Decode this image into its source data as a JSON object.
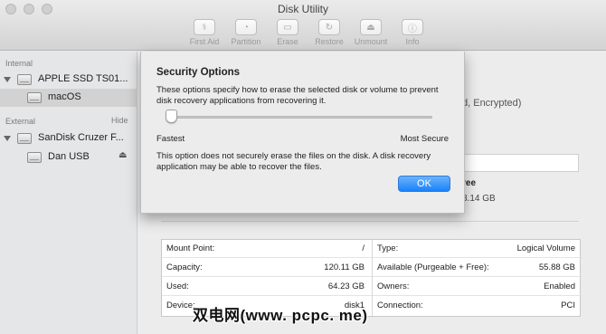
{
  "window": {
    "title": "Disk Utility"
  },
  "toolbar": {
    "buttons": [
      {
        "label": "First Aid",
        "icon": "stethoscope-icon",
        "glyph": "⚕"
      },
      {
        "label": "Partition",
        "icon": "pie-chart-icon",
        "glyph": "◔"
      },
      {
        "label": "Erase",
        "icon": "eraser-icon",
        "glyph": "▭"
      },
      {
        "label": "Restore",
        "icon": "restore-icon",
        "glyph": "↻"
      },
      {
        "label": "Unmount",
        "icon": "eject-icon",
        "glyph": "⏏"
      },
      {
        "label": "Info",
        "icon": "info-icon",
        "glyph": "ⓘ"
      }
    ]
  },
  "sidebar": {
    "internal_header": "Internal",
    "external_header": "External",
    "hide_label": "Hide",
    "items": [
      {
        "label": "APPLE SSD TS01...",
        "level": 0
      },
      {
        "label": "macOS",
        "level": 1
      },
      {
        "label": "SanDisk Cruzer F...",
        "level": 0
      },
      {
        "label": "Dan USB",
        "level": 1
      }
    ]
  },
  "main": {
    "volume_desc_partial": "d, Encrypted)",
    "free_label_partial": "ree",
    "free_value_partial": "8.14 GB",
    "info_left": [
      {
        "key": "Mount Point:",
        "value": "/"
      },
      {
        "key": "Capacity:",
        "value": "120.11 GB"
      },
      {
        "key": "Used:",
        "value": "64.23 GB"
      },
      {
        "key": "Device:",
        "value": "disk1"
      }
    ],
    "info_right": [
      {
        "key": "Type:",
        "value": "Logical Volume"
      },
      {
        "key": "Available (Purgeable + Free):",
        "value": "55.88 GB"
      },
      {
        "key": "Owners:",
        "value": "Enabled"
      },
      {
        "key": "Connection:",
        "value": "PCI"
      }
    ]
  },
  "security_sheet": {
    "title": "Security Options",
    "description": "These options specify how to erase the selected disk or volume to prevent disk recovery applications from recovering it.",
    "slider_min_label": "Fastest",
    "slider_max_label": "Most Secure",
    "slider_level": 0,
    "note": "This option does not securely erase the files on the disk. A disk recovery application may be able to recover the files.",
    "ok_label": "OK"
  },
  "colors": {
    "accent": "#1a82fb"
  },
  "watermark": "双电网(www. pcpc. me)"
}
